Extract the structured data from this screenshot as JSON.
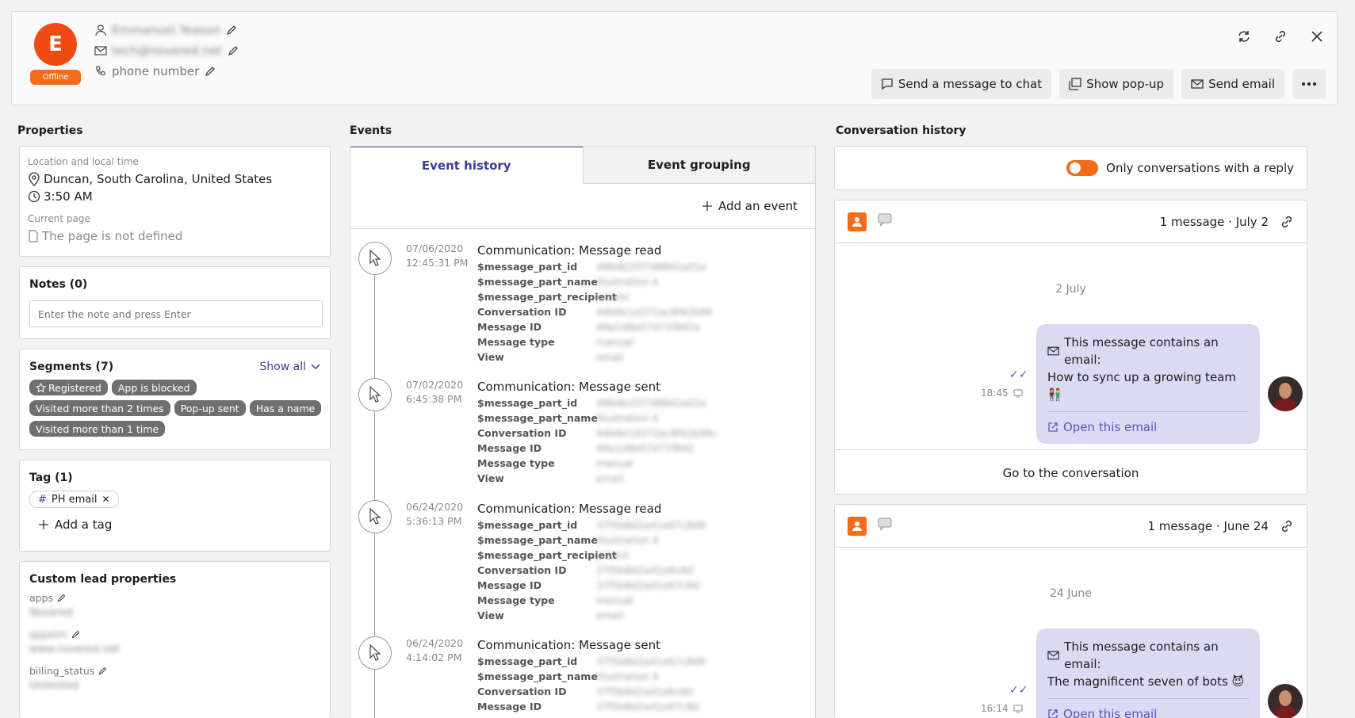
{
  "profile": {
    "initial": "E",
    "status": "Offline",
    "name": "Emmanuel Yeason",
    "email": "tech@novered.net",
    "phone_placeholder": "phone number"
  },
  "header_actions": {
    "send_chat": "Send a message to chat",
    "show_popup": "Show pop-up",
    "send_email": "Send email"
  },
  "sections": {
    "properties": "Properties",
    "events": "Events",
    "conversations": "Conversation history"
  },
  "location": {
    "label": "Location and local time",
    "place": "Duncan, South Carolina, United States",
    "time": "3:50 AM",
    "page_label": "Current page",
    "page_value": "The page is not defined"
  },
  "notes": {
    "title": "Notes (0)",
    "placeholder": "Enter the note and press Enter"
  },
  "segments": {
    "title": "Segments (7)",
    "show_all": "Show all",
    "items": [
      "Registered",
      "App is blocked",
      "Visited more than 2 times",
      "Pop-up sent",
      "Has a name",
      "Visited more than 1 time"
    ]
  },
  "tags": {
    "title": "Tag (1)",
    "items": [
      "PH email"
    ],
    "add": "Add a tag"
  },
  "custom": {
    "title": "Custom lead properties",
    "props": [
      {
        "key": "apps",
        "value": "Novered"
      },
      {
        "key": "appsUrl",
        "value": "www.novered.net"
      },
      {
        "key": "billing_status",
        "value": "Unlimited"
      }
    ]
  },
  "event_tabs": {
    "history": "Event history",
    "grouping": "Event grouping",
    "add": "Add an event"
  },
  "events": [
    {
      "date": "07/06/2020",
      "time": "12:45:31 PM",
      "title": "Communication: Message read",
      "props": [
        [
          "$message_part_id",
          "4864b1f37d8842a01e"
        ],
        [
          "$message_part_name",
          "Illustration 4"
        ],
        [
          "$message_part_recipient",
          "Juliann"
        ],
        [
          "Conversation ID",
          "44b8e1d372ac8f42b99"
        ],
        [
          "Message ID",
          "49a1d8e07d71f842a"
        ],
        [
          "Message type",
          "manual"
        ],
        [
          "View",
          "email"
        ]
      ]
    },
    {
      "date": "07/02/2020",
      "time": "6:45:38 PM",
      "title": "Communication: Message sent",
      "props": [
        [
          "$message_part_id",
          "4864b1f37d8842a01e"
        ],
        [
          "$message_part_name",
          "Illustration 4"
        ],
        [
          "Conversation ID",
          "44b8e1d372ac8f42b99c"
        ],
        [
          "Message ID",
          "49a1d8e07d71f842"
        ],
        [
          "Message type",
          "manual"
        ],
        [
          "View",
          "email"
        ]
      ]
    },
    {
      "date": "06/24/2020",
      "time": "5:36:13 PM",
      "title": "Communication: Message read",
      "props": [
        [
          "$message_part_id",
          "37f5b8d2a41e67c8d9"
        ],
        [
          "$message_part_name",
          "Illustration 4"
        ],
        [
          "$message_part_recipient",
          "Juliann"
        ],
        [
          "Conversation ID",
          "37f5b8d2a41e6c8d"
        ],
        [
          "Message ID",
          "37f5b8d2a41e67c8d"
        ],
        [
          "Message type",
          "manual"
        ],
        [
          "View",
          "email"
        ]
      ]
    },
    {
      "date": "06/24/2020",
      "time": "4:14:02 PM",
      "title": "Communication: Message sent",
      "props": [
        [
          "$message_part_id",
          "37f5b8d2a41e67c8d9"
        ],
        [
          "$message_part_name",
          "Illustration 4"
        ],
        [
          "Conversation ID",
          "37f5b8d2a41e6c8d"
        ],
        [
          "Message ID",
          "37f5b8d2a41e67c8d"
        ]
      ]
    }
  ],
  "conv_filter": "Only conversations with a reply",
  "conversations": [
    {
      "meta": "1 message · July 2",
      "day": "2 July",
      "line1": "This message contains an email:",
      "line2": "How to sync up a growing team 👫",
      "open": "Open this email",
      "time": "18:45",
      "goto": "Go to the conversation"
    },
    {
      "meta": "1 message · June 24",
      "day": "24 June",
      "line1": "This message contains an email:",
      "line2": "The magnificent seven of bots 😈",
      "open": "Open this email",
      "time": "16:14"
    }
  ]
}
